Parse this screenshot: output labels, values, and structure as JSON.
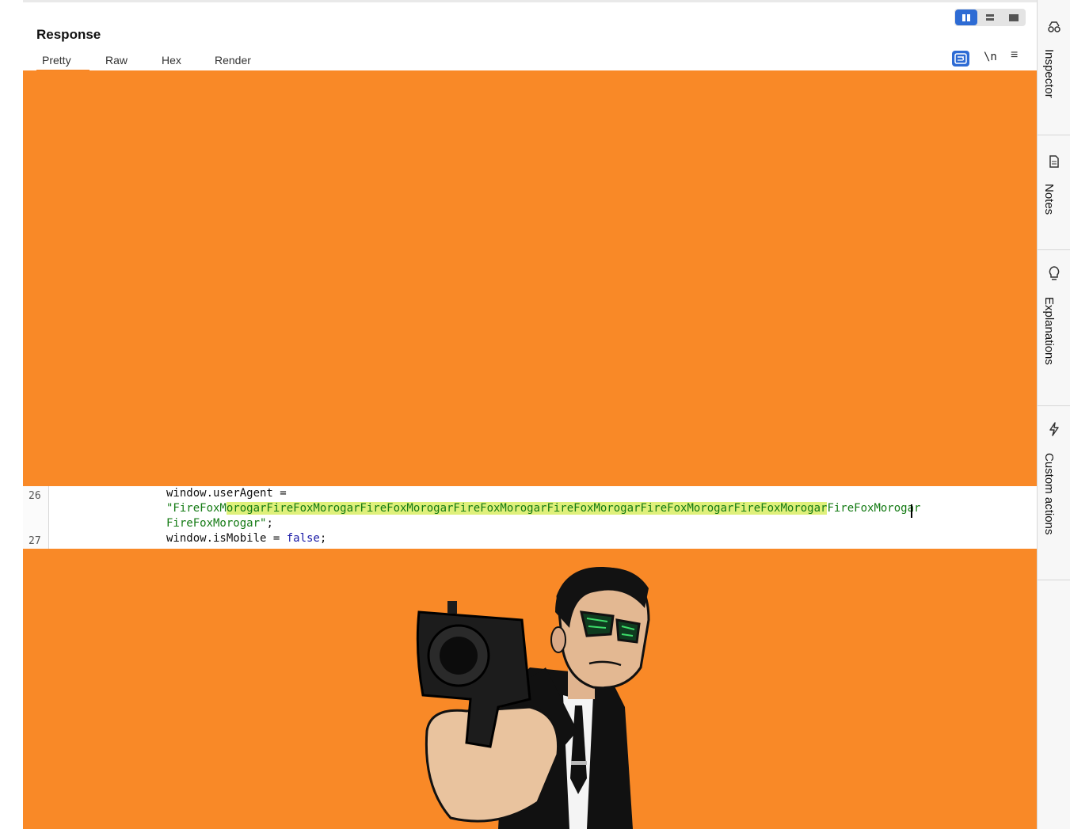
{
  "response": {
    "title": "Response",
    "tabs": [
      "Pretty",
      "Raw",
      "Hex",
      "Render"
    ],
    "active_tab": "Pretty",
    "toolbar": {
      "newline_label": "\\n",
      "menu_glyph": "≡"
    }
  },
  "code": {
    "lines": [
      {
        "number": "26",
        "text": "window.userAgent ="
      },
      {
        "number": "",
        "string_prefix": "\"FireFoxM",
        "string_highlighted": "orogarFireFoxMorogarFireFoxMorogarFireFoxMorogarFireFoxMorogarFireFoxMorogarFireFoxMorogar",
        "string_suffix": "FireFoxMorogar"
      },
      {
        "number": "",
        "string_end": "FireFoxMorogar\"",
        "punct": ";"
      },
      {
        "number": "27",
        "text_prefix": "window.isMobile = ",
        "keyword": "false",
        "punct": ";"
      }
    ]
  },
  "sidebar": {
    "tabs": [
      {
        "label": "Inspector",
        "icon": "inspector-icon"
      },
      {
        "label": "Notes",
        "icon": "notes-icon"
      },
      {
        "label": "Explanations",
        "icon": "lightbulb-icon"
      },
      {
        "label": "Custom actions",
        "icon": "lightning-icon"
      }
    ]
  },
  "colors": {
    "accent": "#2d6bd4",
    "orange": "#f98927",
    "tab_underline": "#f58525",
    "string": "#137a13",
    "highlight": "#dff07a"
  }
}
